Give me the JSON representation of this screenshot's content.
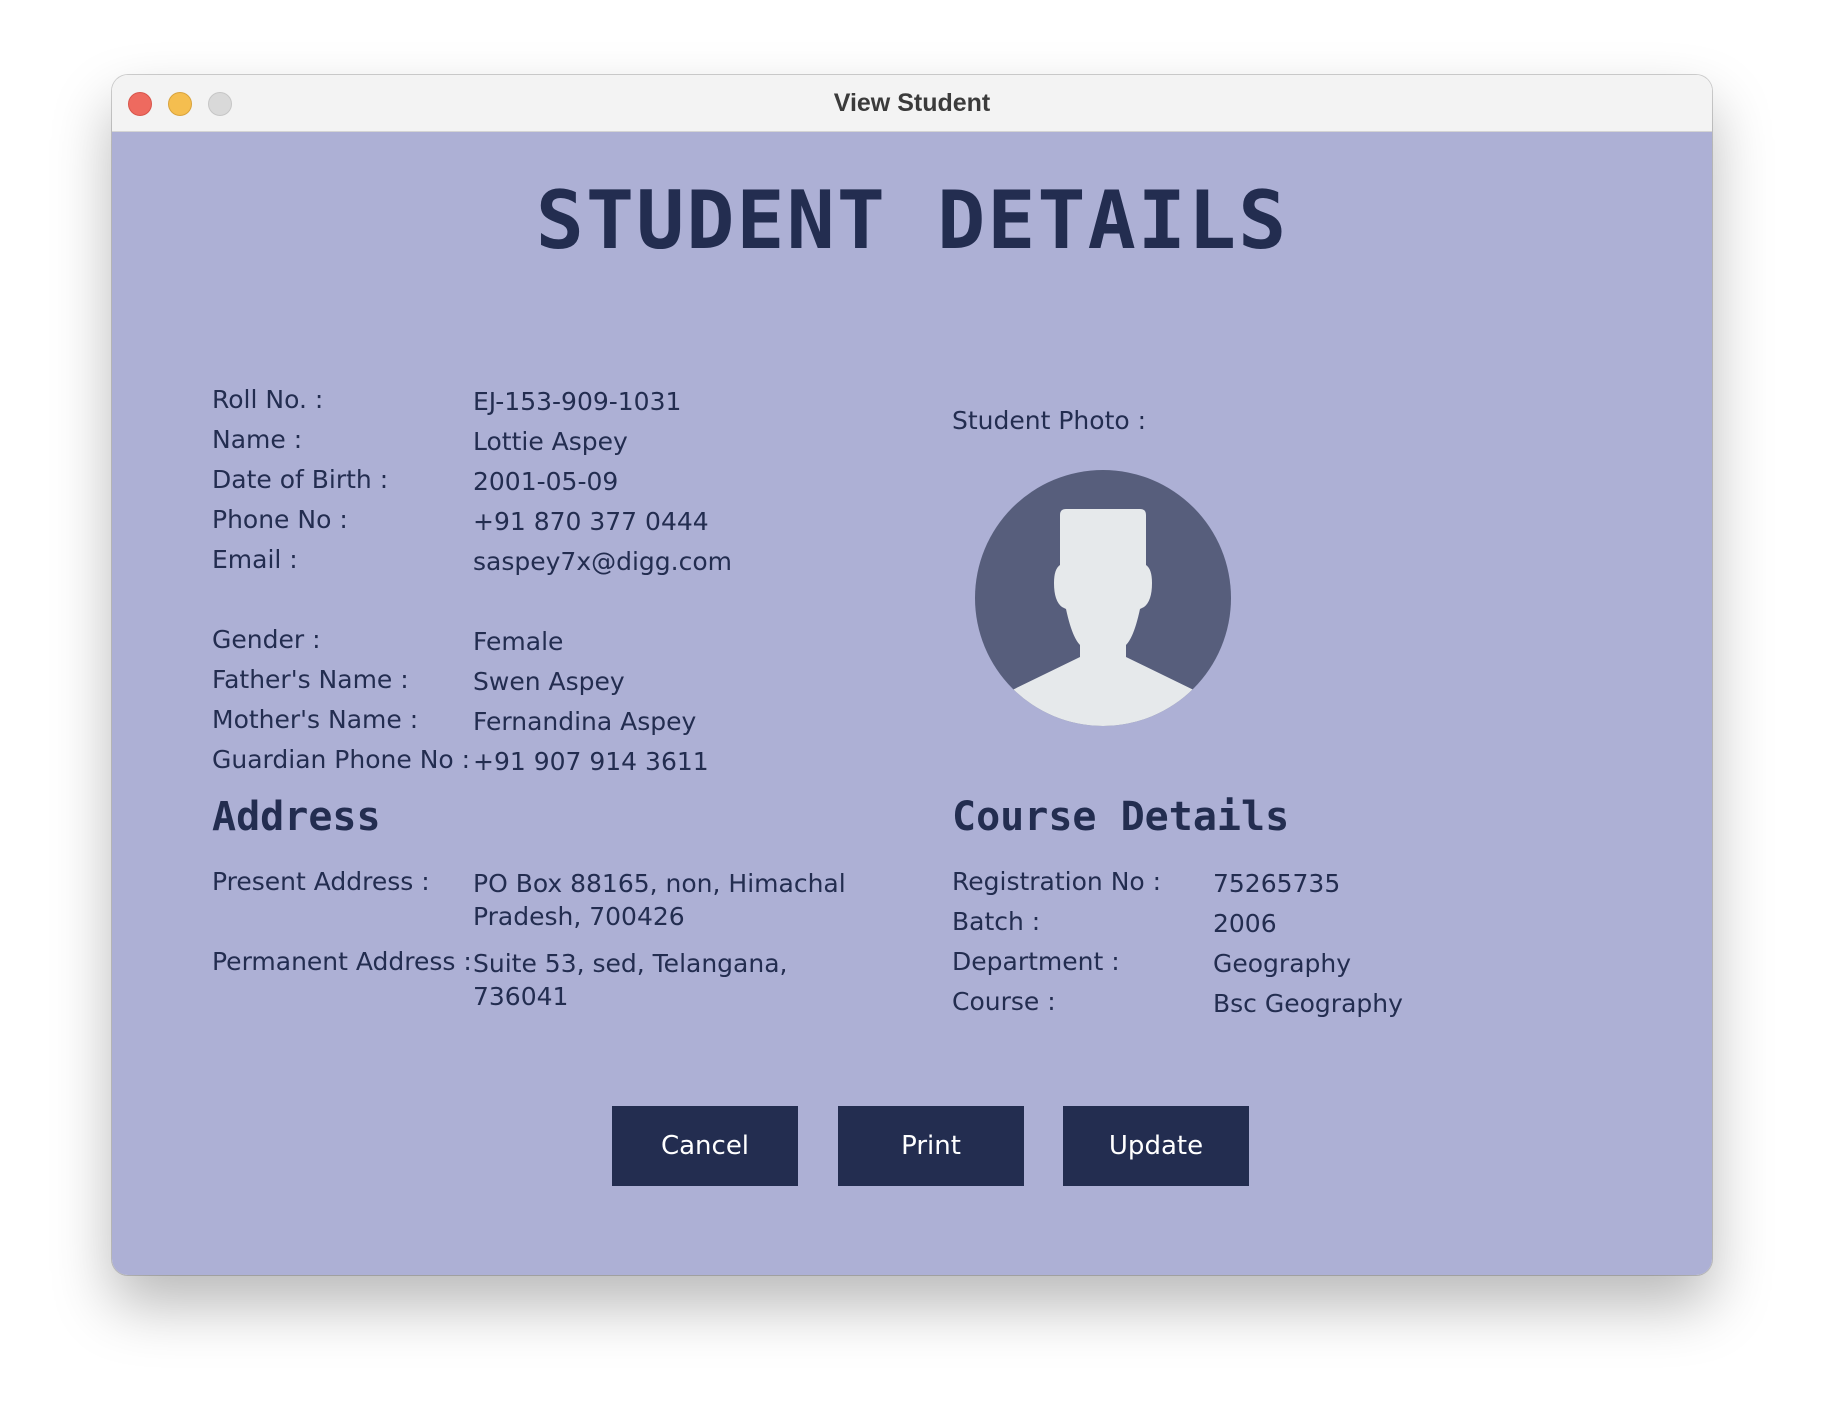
{
  "window": {
    "title": "View Student"
  },
  "page_title": "STUDENT DETAILS",
  "personal": {
    "roll_label": "Roll No. :",
    "roll_value": "EJ-153-909-1031",
    "name_label": "Name :",
    "name_value": "Lottie Aspey",
    "dob_label": "Date of Birth :",
    "dob_value": "2001-05-09",
    "phone_label": "Phone No :",
    "phone_value": "+91 870 377 0444",
    "email_label": "Email :",
    "email_value": "saspey7x@digg.com",
    "gender_label": "Gender :",
    "gender_value": "Female",
    "father_label": "Father's Name :",
    "father_value": "Swen Aspey",
    "mother_label": "Mother's Name :",
    "mother_value": "Fernandina Aspey",
    "guardian_label": "Guardian Phone No :",
    "guardian_value": "+91 907 914 3611"
  },
  "photo": {
    "label": "Student Photo :",
    "icon": "person-silhouette-icon"
  },
  "address": {
    "heading": "Address",
    "present_label": "Present Address :",
    "present_value": "PO Box 88165, non, Himachal Pradesh, 700426",
    "permanent_label": "Permanent Address :",
    "permanent_value": "Suite 53, sed, Telangana, 736041"
  },
  "course": {
    "heading": "Course Details",
    "reg_label": "Registration No :",
    "reg_value": "75265735",
    "batch_label": "Batch :",
    "batch_value": "2006",
    "dept_label": "Department :",
    "dept_value": "Geography",
    "course_label": "Course :",
    "course_value": "Bsc Geography"
  },
  "buttons": {
    "cancel": "Cancel",
    "print": "Print",
    "update": "Update"
  },
  "colors": {
    "background": "#adb0d5",
    "text": "#232d50",
    "button": "#232d50",
    "avatar_bg": "#575e7c",
    "avatar_fg": "#e6e9eb"
  }
}
